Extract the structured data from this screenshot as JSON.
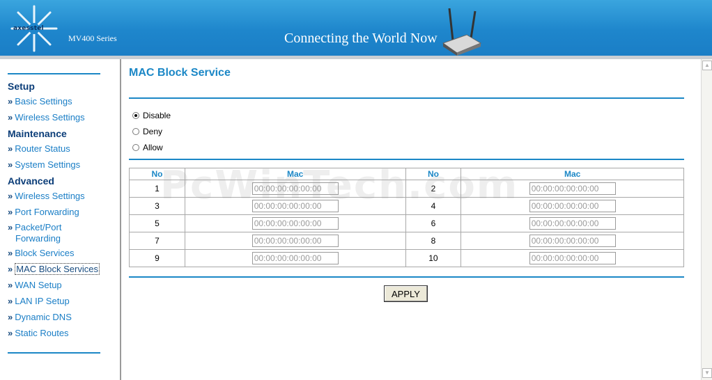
{
  "header": {
    "brand": "axesstel",
    "series": "MV400 Series",
    "tagline": "Connecting the World Now"
  },
  "sidebar": {
    "sections": [
      {
        "title": "Setup",
        "items": [
          {
            "label": "Basic Settings"
          },
          {
            "label": "Wireless Settings"
          }
        ]
      },
      {
        "title": "Maintenance",
        "items": [
          {
            "label": "Router Status"
          },
          {
            "label": "System Settings"
          }
        ]
      },
      {
        "title": "Advanced",
        "items": [
          {
            "label": "Wireless Settings"
          },
          {
            "label": "Port Forwarding"
          },
          {
            "label": "Packet/Port"
          },
          {
            "label": "Forwarding"
          },
          {
            "label": "Block Services"
          },
          {
            "label": "MAC Block Services",
            "active": true
          },
          {
            "label": "WAN Setup"
          },
          {
            "label": "LAN IP Setup"
          },
          {
            "label": "Dynamic DNS"
          },
          {
            "label": "Static Routes"
          }
        ]
      }
    ],
    "bullet": "»"
  },
  "main": {
    "title": "MAC Block Service",
    "options": [
      {
        "label": "Disable",
        "checked": true
      },
      {
        "label": "Deny",
        "checked": false
      },
      {
        "label": "Allow",
        "checked": false
      }
    ],
    "table": {
      "headers": [
        "No",
        "Mac",
        "No",
        "Mac"
      ],
      "rows": [
        {
          "no1": "1",
          "mac1": "00:00:00:00:00:00",
          "no2": "2",
          "mac2": "00:00:00:00:00:00"
        },
        {
          "no1": "3",
          "mac1": "00:00:00:00:00:00",
          "no2": "4",
          "mac2": "00:00:00:00:00:00"
        },
        {
          "no1": "5",
          "mac1": "00:00:00:00:00:00",
          "no2": "6",
          "mac2": "00:00:00:00:00:00"
        },
        {
          "no1": "7",
          "mac1": "00:00:00:00:00:00",
          "no2": "8",
          "mac2": "00:00:00:00:00:00"
        },
        {
          "no1": "9",
          "mac1": "00:00:00:00:00:00",
          "no2": "10",
          "mac2": "00:00:00:00:00:00"
        }
      ]
    },
    "apply_label": "APPLY",
    "watermark": "PcWinTech.com"
  },
  "colors": {
    "accent": "#1b87c6",
    "header_blue": "#1e86cc",
    "nav_dark": "#0b3d78"
  },
  "icons": {
    "scroll_up": "triangle-up",
    "scroll_down": "triangle-down"
  }
}
